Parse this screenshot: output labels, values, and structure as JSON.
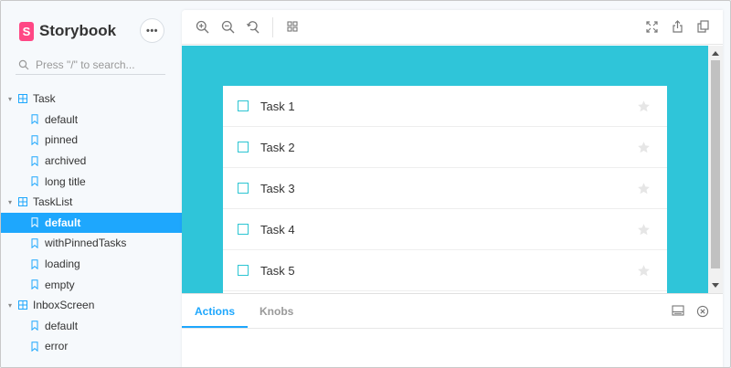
{
  "brand": {
    "logo_letter": "S",
    "name": "Storybook",
    "menu_label": "•••",
    "logo_color": "#ff4785"
  },
  "search": {
    "placeholder": "Press \"/\" to search..."
  },
  "tree": {
    "groups": [
      {
        "label": "Task",
        "stories": [
          "default",
          "pinned",
          "archived",
          "long title"
        ]
      },
      {
        "label": "TaskList",
        "stories": [
          "default",
          "withPinnedTasks",
          "loading",
          "empty"
        ]
      },
      {
        "label": "InboxScreen",
        "stories": [
          "default",
          "error"
        ]
      }
    ],
    "selected": {
      "group": "TaskList",
      "story": "default"
    }
  },
  "toolbar": {
    "left_icons": [
      "zoom-in-icon",
      "zoom-out-icon",
      "zoom-reset-icon",
      "grid-icon"
    ],
    "right_icons": [
      "fullscreen-icon",
      "share-icon",
      "copy-icon"
    ]
  },
  "preview": {
    "background": "#2fc5d9",
    "tasks": [
      {
        "title": "Task 1"
      },
      {
        "title": "Task 2"
      },
      {
        "title": "Task 3"
      },
      {
        "title": "Task 4"
      },
      {
        "title": "Task 5"
      }
    ]
  },
  "addons": {
    "tabs": [
      {
        "label": "Actions",
        "active": true
      },
      {
        "label": "Knobs",
        "active": false
      }
    ],
    "icons": [
      "panel-toggle-icon",
      "close-icon"
    ]
  },
  "colors": {
    "accent": "#1ea7fd",
    "checkbox": "#2cc5d2"
  }
}
